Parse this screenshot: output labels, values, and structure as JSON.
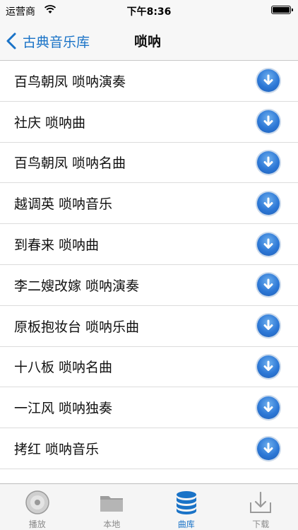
{
  "status": {
    "carrier": "运营商",
    "time": "下午8:36",
    "battery_level": 1.0
  },
  "nav": {
    "back_label": "古典音乐库",
    "title": "唢呐"
  },
  "list": {
    "items": [
      {
        "title": "百鸟朝凤 唢呐演奏"
      },
      {
        "title": "社庆 唢呐曲"
      },
      {
        "title": "百鸟朝凤 唢呐名曲"
      },
      {
        "title": "越调英 唢呐音乐"
      },
      {
        "title": "到春来 唢呐曲"
      },
      {
        "title": "李二嫂改嫁 唢呐演奏"
      },
      {
        "title": "原板抱妆台 唢呐乐曲"
      },
      {
        "title": "十八板 唢呐名曲"
      },
      {
        "title": "一江风 唢呐独奏"
      },
      {
        "title": "拷红 唢呐音乐"
      }
    ]
  },
  "tabs": [
    {
      "label": "播放",
      "icon": "disc-icon",
      "active": false
    },
    {
      "label": "本地",
      "icon": "folder-icon",
      "active": false
    },
    {
      "label": "曲库",
      "icon": "database-icon",
      "active": true
    },
    {
      "label": "下载",
      "icon": "download-tray-icon",
      "active": false
    }
  ],
  "colors": {
    "accent": "#1a73c7",
    "download_button": "#2d78d6"
  }
}
